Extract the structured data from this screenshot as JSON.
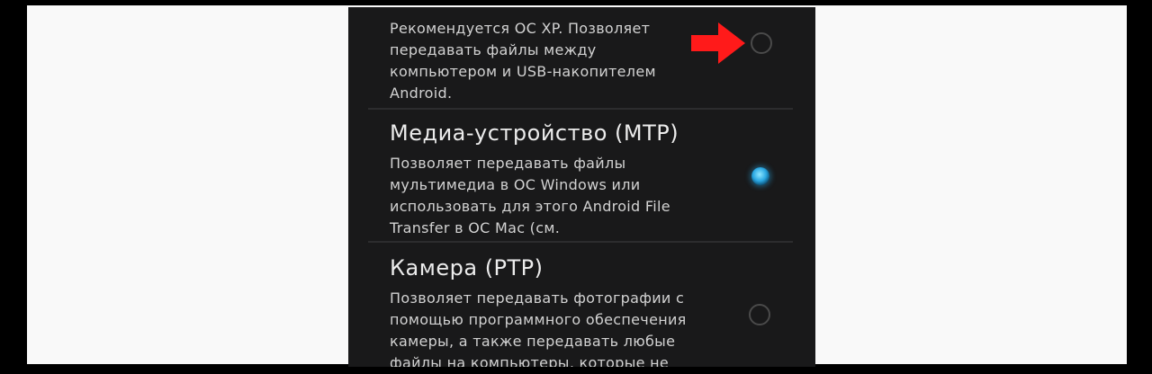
{
  "usb_mode_options": [
    {
      "title": "",
      "description_lines": [
        "Рекомендуется ОС XP. Позволяет",
        "передавать файлы между",
        "компьютером и USB-накопителем",
        "Android."
      ],
      "selected": false
    },
    {
      "title": "Медиа-устройство (MTP)",
      "description_lines": [
        "Позволяет передавать файлы",
        "мультимедиа в ОС Windows или",
        "использовать для этого Android File",
        "Transfer в ОС Mac (см."
      ],
      "selected": true
    },
    {
      "title": "Камера (PTP)",
      "description_lines": [
        "Позволяет передавать фотографии с",
        "помощью программного обеспечения",
        "камеры, а также передавать любые",
        "файлы на компьютеры, которые не"
      ],
      "selected": false
    }
  ],
  "colors": {
    "background": "#f9f9f9",
    "phone_screen": "#19191a",
    "accent_radio": "#2aa7e2",
    "arrow": "#ff1a1a"
  },
  "icons": {
    "annotation": "red-arrow-icon"
  }
}
